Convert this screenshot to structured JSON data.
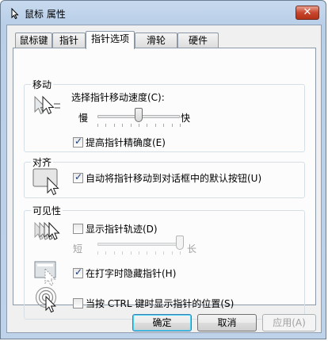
{
  "window": {
    "title": "鼠标 属性",
    "close_symbol": "✕"
  },
  "tabs": [
    {
      "label": "鼠标键"
    },
    {
      "label": "指针"
    },
    {
      "label": "指针选项"
    },
    {
      "label": "滑轮"
    },
    {
      "label": "硬件"
    }
  ],
  "active_tab": "指针选项",
  "motion": {
    "group_label": "移动",
    "speed_label": "选择指针移动速度(C):",
    "slow_label": "慢",
    "fast_label": "快",
    "speed_level": 0.5,
    "precision_label": "提高指针精确度(E)",
    "precision_checked": true
  },
  "snap": {
    "group_label": "对齐",
    "snap_label": "自动将指针移动到对话框中的默认按钮(U)",
    "snap_checked": true
  },
  "visibility": {
    "group_label": "可见性",
    "trails_label": "显示指针轨迹(D)",
    "trails_checked": false,
    "short_label": "短",
    "long_label": "长",
    "trails_level": 1.0,
    "hide_label": "在打字时隐藏指针(H)",
    "hide_checked": true,
    "ctrl_label": "当按 CTRL 键时显示指针的位置(S)",
    "ctrl_checked": false
  },
  "buttons": {
    "ok": "确定",
    "cancel": "取消",
    "apply": "应用(A)"
  },
  "check_symbol": "✓"
}
